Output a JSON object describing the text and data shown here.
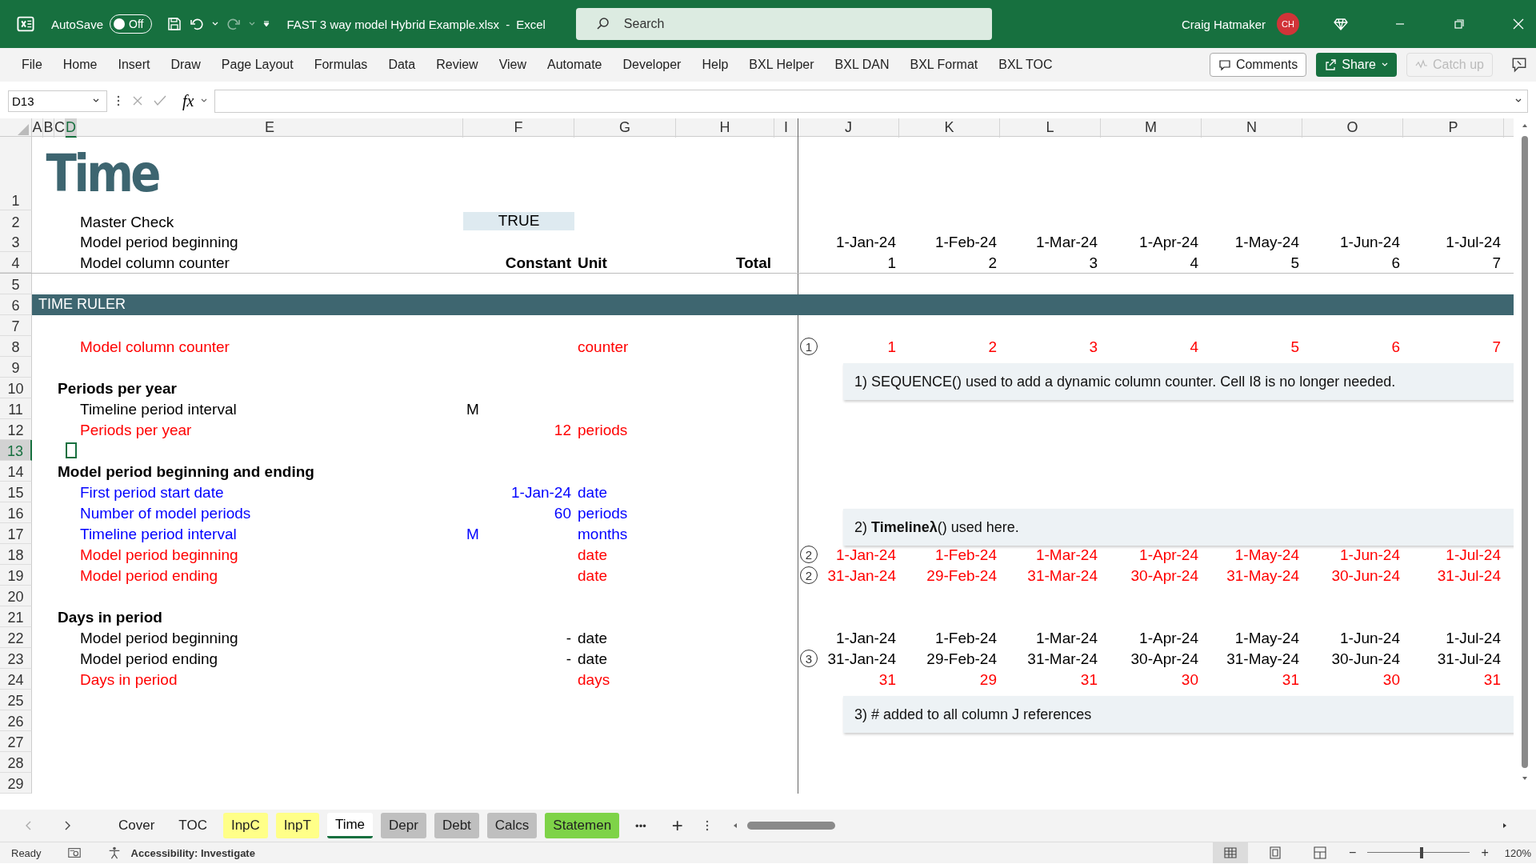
{
  "window": {
    "autosave_label": "AutoSave",
    "autosave_on": false,
    "autosave_state": "Off",
    "file_name": "FAST 3 way model Hybrid Example.xlsx",
    "separator": "-",
    "app_name": "Excel",
    "search_placeholder": "Search",
    "user_name": "Craig Hatmaker",
    "user_initials": "CH"
  },
  "ribbon_tabs": [
    "File",
    "Home",
    "Insert",
    "Draw",
    "Page Layout",
    "Formulas",
    "Data",
    "Review",
    "View",
    "Automate",
    "Developer",
    "Help",
    "BXL Helper",
    "BXL DAN",
    "BXL Format",
    "BXL TOC"
  ],
  "ribbon_buttons": [
    {
      "label": "Comments",
      "kind": "comments",
      "disabled": false
    },
    {
      "label": "Share",
      "kind": "share",
      "disabled": false
    },
    {
      "label": "Catch up",
      "kind": "catchup",
      "disabled": true
    }
  ],
  "formula_bar": {
    "name_box": "D13",
    "fx": "fx"
  },
  "columns": [
    {
      "label": "A",
      "selected": false
    },
    {
      "label": "B",
      "selected": false
    },
    {
      "label": "C",
      "selected": false
    },
    {
      "label": "D",
      "selected": true
    },
    {
      "label": "E",
      "selected": false
    },
    {
      "label": "F",
      "selected": false
    },
    {
      "label": "G",
      "selected": false
    },
    {
      "label": "H",
      "selected": false
    },
    {
      "label": "I",
      "selected": false
    },
    {
      "label": "J",
      "selected": false
    },
    {
      "label": "K",
      "selected": false
    },
    {
      "label": "L",
      "selected": false
    },
    {
      "label": "M",
      "selected": false
    },
    {
      "label": "N",
      "selected": false
    },
    {
      "label": "O",
      "selected": false
    },
    {
      "label": "P",
      "selected": false
    }
  ],
  "rows": [
    {
      "number": "1",
      "selected": false,
      "kind": "title",
      "title": "Time"
    },
    {
      "number": "2",
      "selected": false,
      "kind": "check",
      "label": "Master Check",
      "constant": "TRUE"
    },
    {
      "number": "3",
      "selected": false,
      "kind": "label",
      "label": "Model period beginning",
      "values": [
        "1-Jan-24",
        "1-Feb-24",
        "1-Mar-24",
        "1-Apr-24",
        "1-May-24",
        "1-Jun-24",
        "1-Jul-24"
      ]
    },
    {
      "number": "4",
      "selected": false,
      "kind": "column_headings",
      "label": "Model column counter",
      "constant": "Constant",
      "unit": "Unit",
      "total": "Total",
      "values": [
        "1",
        "2",
        "3",
        "4",
        "5",
        "6",
        "7"
      ]
    },
    {
      "number": "5",
      "selected": false
    },
    {
      "number": "6",
      "selected": false,
      "kind": "section",
      "title": "TIME RULER"
    },
    {
      "number": "7",
      "selected": false
    },
    {
      "number": "8",
      "selected": false,
      "kind": "calc",
      "label": "Model column counter",
      "unit": "counter",
      "marker": "1",
      "values": [
        "1",
        "2",
        "3",
        "4",
        "5",
        "6",
        "7"
      ]
    },
    {
      "number": "9",
      "selected": false,
      "note": "1) SEQUENCE() used to add a dynamic column counter. Cell I8 is no longer needed."
    },
    {
      "number": "10",
      "selected": false,
      "kind": "heading",
      "title": "Periods per year"
    },
    {
      "number": "11",
      "selected": false,
      "kind": "label",
      "label": "Timeline period interval",
      "constant_text": "M"
    },
    {
      "number": "12",
      "selected": false,
      "kind": "calc",
      "label": "Periods per year",
      "constant": "12",
      "unit": "periods"
    },
    {
      "number": "13",
      "selected": true
    },
    {
      "number": "14",
      "selected": false,
      "kind": "heading",
      "title": "Model period beginning and ending"
    },
    {
      "number": "15",
      "selected": false,
      "kind": "input",
      "label": "First period start date",
      "constant": "1-Jan-24",
      "unit": "date"
    },
    {
      "number": "16",
      "selected": false,
      "kind": "input",
      "label": "Number of model periods",
      "constant": "60",
      "unit": "periods",
      "note": "2) **Timelineλ**() used here."
    },
    {
      "number": "17",
      "selected": false,
      "kind": "input",
      "label": "Timeline period interval",
      "constant_text": "M",
      "unit": "months"
    },
    {
      "number": "18",
      "selected": false,
      "kind": "calc",
      "label": "Model period beginning",
      "unit": "date",
      "marker": "2",
      "values": [
        "1-Jan-24",
        "1-Feb-24",
        "1-Mar-24",
        "1-Apr-24",
        "1-May-24",
        "1-Jun-24",
        "1-Jul-24"
      ]
    },
    {
      "number": "19",
      "selected": false,
      "kind": "calc",
      "label": "Model period ending",
      "unit": "date",
      "marker": "2",
      "values": [
        "31-Jan-24",
        "29-Feb-24",
        "31-Mar-24",
        "30-Apr-24",
        "31-May-24",
        "30-Jun-24",
        "31-Jul-24"
      ]
    },
    {
      "number": "20",
      "selected": false
    },
    {
      "number": "21",
      "selected": false,
      "kind": "heading",
      "title": "Days in period"
    },
    {
      "number": "22",
      "selected": false,
      "kind": "label",
      "label": "Model period beginning",
      "constant": "-",
      "unit": "date",
      "values": [
        "1-Jan-24",
        "1-Feb-24",
        "1-Mar-24",
        "1-Apr-24",
        "1-May-24",
        "1-Jun-24",
        "1-Jul-24"
      ]
    },
    {
      "number": "23",
      "selected": false,
      "kind": "label",
      "label": "Model period ending",
      "constant": "-",
      "unit": "date",
      "marker": "3",
      "values": [
        "31-Jan-24",
        "29-Feb-24",
        "31-Mar-24",
        "30-Apr-24",
        "31-May-24",
        "30-Jun-24",
        "31-Jul-24"
      ]
    },
    {
      "number": "24",
      "selected": false,
      "kind": "calc",
      "label": "Days in period",
      "unit": "days",
      "values": [
        "31",
        "29",
        "31",
        "30",
        "31",
        "30",
        "31"
      ]
    },
    {
      "number": "25",
      "selected": false,
      "note": "3) # added to all column J references"
    },
    {
      "number": "26",
      "selected": false
    },
    {
      "number": "27",
      "selected": false
    },
    {
      "number": "28",
      "selected": false
    },
    {
      "number": "29",
      "selected": false
    }
  ],
  "sheet_tabs": [
    {
      "label": "Cover",
      "selected": false
    },
    {
      "label": "TOC",
      "selected": false
    },
    {
      "label": "InpC",
      "selected": false,
      "color": "#ffff88"
    },
    {
      "label": "InpT",
      "selected": false,
      "color": "#ffff88"
    },
    {
      "label": "Time",
      "selected": true
    },
    {
      "label": "Depr",
      "selected": false,
      "color": "#bfbfbf"
    },
    {
      "label": "Debt",
      "selected": false,
      "color": "#bfbfbf"
    },
    {
      "label": "Calcs",
      "selected": false,
      "color": "#bfbfbf"
    },
    {
      "label": "Statemen",
      "selected": false,
      "color": "#7ed348"
    }
  ],
  "sheet_more": "•••",
  "sheet_add": "+",
  "status_bar": {
    "ready": "Ready",
    "accessibility": "Accessibility: Investigate",
    "zoom_out": "−",
    "zoom_in": "+",
    "zoom": "120%",
    "level": 0.53,
    "views": [
      {
        "kind": "normal",
        "selected": true
      },
      {
        "kind": "layout",
        "selected": false
      },
      {
        "kind": "pagebreak",
        "selected": false
      }
    ]
  }
}
